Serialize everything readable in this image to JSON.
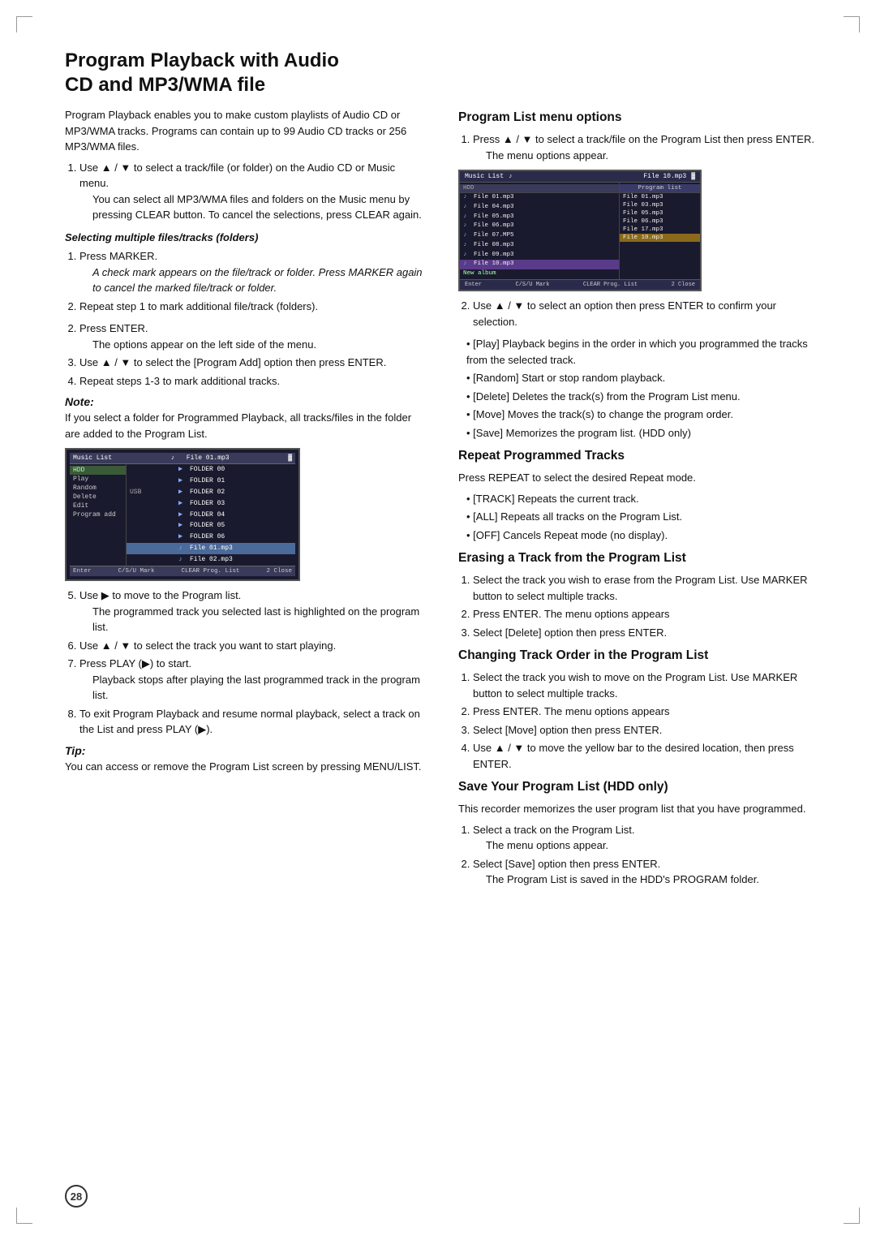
{
  "page": {
    "number": "28",
    "background": "#ffffff"
  },
  "title": {
    "line1": "Program Playback with Audio",
    "line2": "CD and MP3/WMA file"
  },
  "left_col": {
    "intro": "Program Playback enables you to make custom playlists of Audio CD or MP3/WMA tracks. Programs can contain up to 99 Audio CD tracks or 256 MP3/WMA files.",
    "step1": "Use ▲ / ▼ to select a track/file (or folder) on the Audio CD or Music menu.",
    "step1_note": "You can select all MP3/WMA files and folders on the Music menu by pressing CLEAR button. To cancel the selections, press CLEAR again.",
    "selecting_title": "Selecting multiple files/tracks (folders)",
    "sel_step1": "Press MARKER.",
    "sel_step1_note": "A check mark appears on the file/track or folder. Press MARKER again to cancel the marked file/track or folder.",
    "sel_step2": "Repeat step 1 to mark additional file/track (folders).",
    "step2": "Press ENTER.",
    "step2_note": "The options appear on the left side of the menu.",
    "step3": "Use ▲ / ▼ to select the [Program Add] option then press ENTER.",
    "step4": "Repeat steps 1-3 to mark additional tracks.",
    "note_label": "Note:",
    "note_text": "If you select a folder for Programmed Playback, all tracks/files in the folder are added to the Program List.",
    "step5": "Use ▶ to move to the Program list.",
    "step5_note": "The programmed track you selected last is highlighted on the program list.",
    "step6": "Use ▲ / ▼ to select the track you want to start playing.",
    "step7": "Press PLAY (▶) to start.",
    "step7_note": "Playback stops after playing the last programmed track in the program list.",
    "step8": "To exit Program Playback and resume normal playback, select a track on the List and press PLAY (▶).",
    "tip_label": "Tip:",
    "tip_text": "You can access or remove the Program List screen by pressing MENU/LIST."
  },
  "right_col": {
    "prog_list_menu_title": "Program List menu options",
    "plm_step1": "Press ▲ / ▼ to select a track/file on the Program List then press ENTER.",
    "plm_step1_note": "The menu options appear.",
    "plm_step2": "Use ▲ / ▼ to select an option then press ENTER to confirm your selection.",
    "plm_bullets": [
      "[Play] Playback begins in the order in which you programmed the tracks from the selected track.",
      "[Random] Start or stop random playback.",
      "[Delete] Deletes the track(s) from the Program List menu.",
      "[Move] Moves the track(s) to change the program order.",
      "[Save] Memorizes the program list. (HDD only)"
    ],
    "repeat_title": "Repeat Programmed Tracks",
    "repeat_intro": "Press REPEAT to select the desired Repeat mode.",
    "repeat_bullets": [
      "[TRACK] Repeats the current track.",
      "[ALL] Repeats all tracks on the Program List.",
      "[OFF] Cancels Repeat mode (no display)."
    ],
    "erasing_title": "Erasing a Track from the Program List",
    "erasing_step1": "Select the track you wish to erase from the Program List. Use MARKER button to select multiple tracks.",
    "erasing_step2": "Press ENTER. The menu options appears",
    "erasing_step3": "Select [Delete] option then press ENTER.",
    "changing_title": "Changing Track Order in the Program List",
    "changing_step1": "Select the track you wish to move on the Program List. Use MARKER button to select multiple tracks.",
    "changing_step2": "Press ENTER. The menu options appears",
    "changing_step3": "Select [Move] option then press ENTER.",
    "changing_step4": "Use ▲ / ▼ to move the yellow bar to the desired location, then press ENTER.",
    "save_title": "Save Your Program List (HDD only)",
    "save_intro": "This recorder memorizes the user program list that you have programmed.",
    "save_step1": "Select a track on the Program List.",
    "save_step1_note": "The menu options appear.",
    "save_step2": "Select [Save] option then press ENTER.",
    "save_step2_note": "The Program List is saved in the HDD's PROGRAM folder."
  },
  "screen1": {
    "header": "Music List",
    "tab_icon": "♪",
    "file_label": "File 01.mp3",
    "hdd_label": "HDD",
    "rows": [
      {
        "label": "",
        "icon": "▶",
        "name": "FOLDER 00",
        "selected": false
      },
      {
        "label": "",
        "icon": "▶",
        "name": "FOLDER 01",
        "selected": false
      },
      {
        "label": "USB",
        "icon": "▶",
        "name": "FOLDER 02",
        "selected": false
      },
      {
        "label": "",
        "icon": "▶",
        "name": "FOLDER 03",
        "selected": false
      },
      {
        "label": "",
        "icon": "▶",
        "name": "FOLDER 04",
        "selected": false
      },
      {
        "label": "",
        "icon": "▶",
        "name": "FOLDER 05",
        "selected": false
      },
      {
        "label": "",
        "icon": "▶",
        "name": "FOLDER 06",
        "selected": false
      },
      {
        "label": "",
        "icon": "♪",
        "name": "File 01.mp3",
        "selected": true
      },
      {
        "label": "",
        "icon": "♪",
        "name": "File 02.mp3",
        "selected": false
      }
    ],
    "menu_items": [
      "Play",
      "Random",
      "Delete",
      "Edit",
      "Program add"
    ],
    "footer": [
      "Enter",
      "C/S/U Mark",
      "CLEAR Prog. List",
      "2 Close"
    ]
  },
  "screen2": {
    "header_left": "Music List",
    "header_right": "File 10.mp3",
    "hdd_label": "HDD",
    "prog_list_label": "Program list",
    "list_rows": [
      {
        "icon": "♪",
        "name": "File 01.mp3",
        "selected": false
      },
      {
        "icon": "♪",
        "name": "File 04.mp3",
        "selected": false
      },
      {
        "icon": "♪",
        "name": "File 05.mp3",
        "selected": false
      },
      {
        "icon": "♪",
        "name": "File 06.mp3",
        "selected": false
      },
      {
        "icon": "♪",
        "name": "File 07.MP5",
        "selected": false
      },
      {
        "icon": "♪",
        "name": "File 08.mp3",
        "selected": false
      },
      {
        "icon": "♪",
        "name": "File 09.mp3",
        "selected": false
      },
      {
        "icon": "♪",
        "name": "File 10.mp3",
        "selected": true
      }
    ],
    "prog_rows": [
      {
        "name": "File 01.mp3",
        "selected": false
      },
      {
        "name": "File 03.mp3",
        "selected": false
      },
      {
        "name": "File 05.mp3",
        "selected": false
      },
      {
        "name": "File 06.mp3",
        "selected": false
      },
      {
        "name": "File 17.mp3",
        "selected": false
      },
      {
        "name": "File 10.mp3",
        "selected": true
      }
    ],
    "new_album": "New album",
    "footer": [
      "Enter",
      "C/S/U Mark",
      "CLEAR Prog. List",
      "2 Close"
    ]
  }
}
